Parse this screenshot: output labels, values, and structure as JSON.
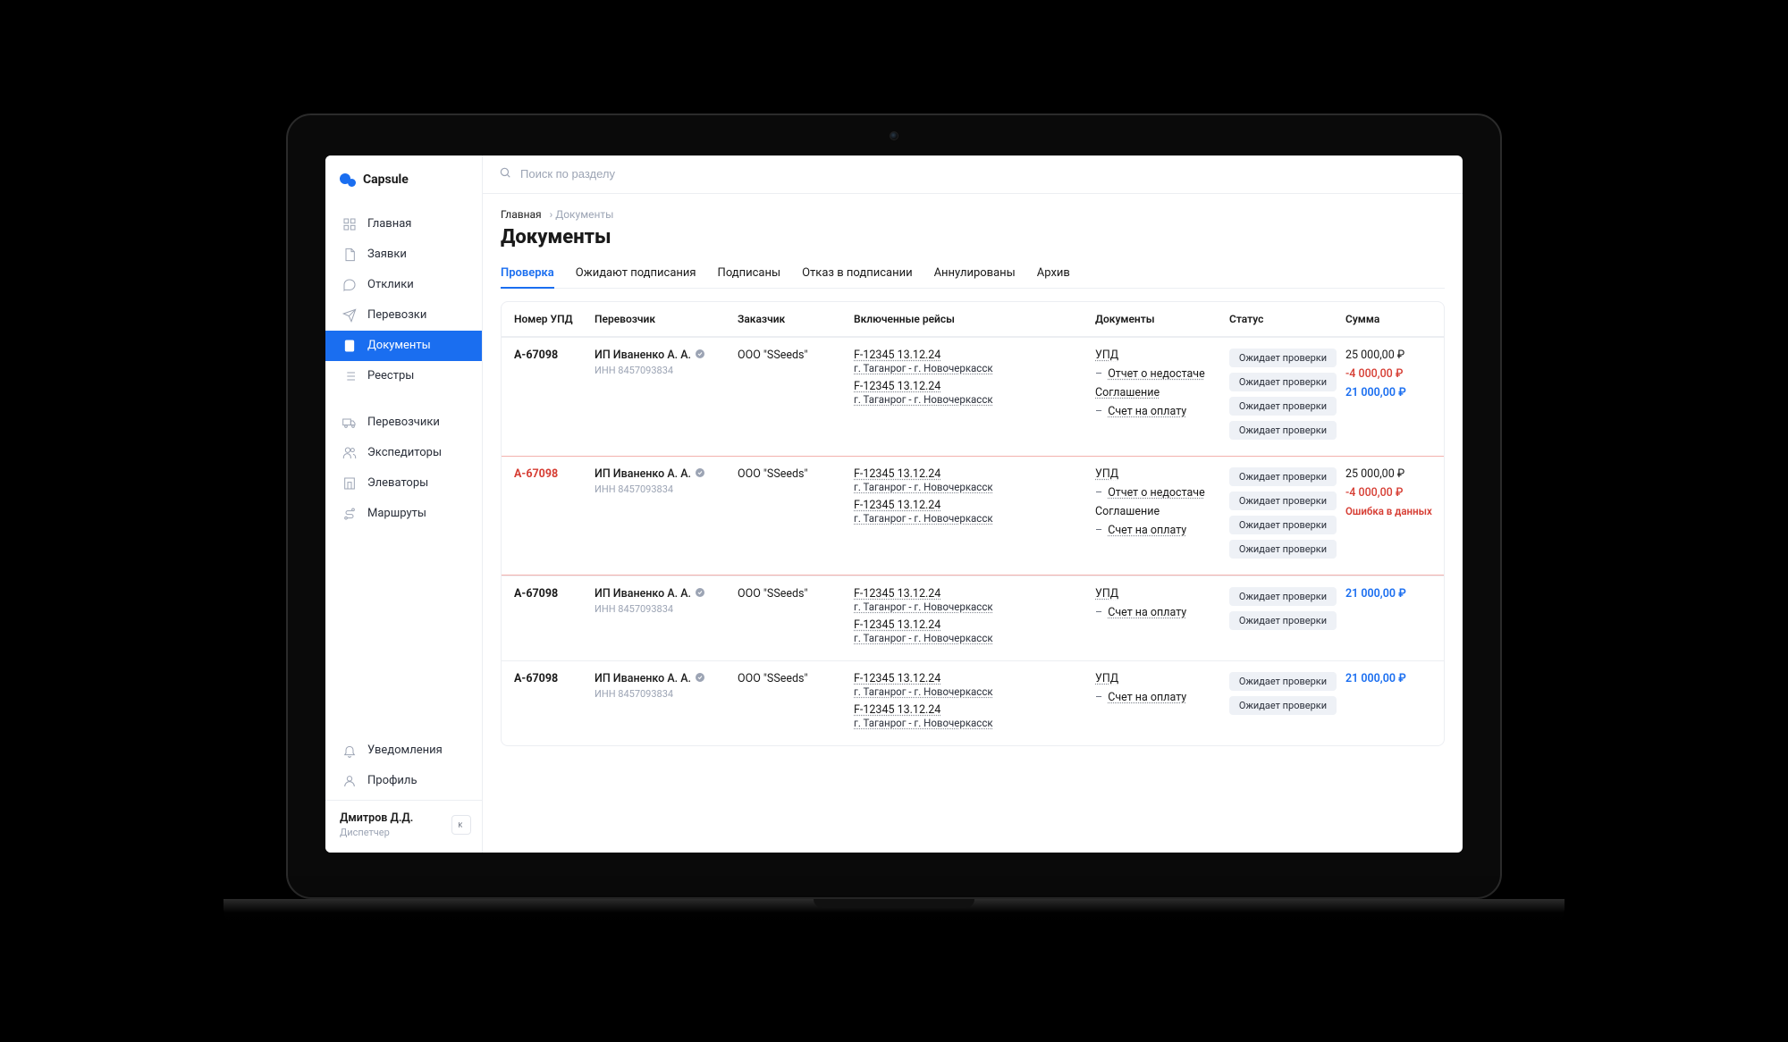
{
  "brand": {
    "name": "Capsule"
  },
  "search": {
    "placeholder": "Поиск по разделу"
  },
  "sidebar": {
    "items": [
      {
        "label": "Главная"
      },
      {
        "label": "Заявки"
      },
      {
        "label": "Отклики"
      },
      {
        "label": "Перевозки"
      },
      {
        "label": "Документы"
      },
      {
        "label": "Реестры"
      },
      {
        "label": "Перевозчики"
      },
      {
        "label": "Экспедиторы"
      },
      {
        "label": "Элеваторы"
      },
      {
        "label": "Маршруты"
      }
    ],
    "bottom": [
      {
        "label": "Уведомления"
      },
      {
        "label": "Профиль"
      }
    ]
  },
  "user": {
    "name": "Дмитров Д.Д.",
    "role": "Диспетчер"
  },
  "breadcrumb": {
    "root": "Главная",
    "current": "Документы"
  },
  "page_title": "Документы",
  "tabs": [
    {
      "label": "Проверка",
      "active": true
    },
    {
      "label": "Ожидают подписания"
    },
    {
      "label": "Подписаны"
    },
    {
      "label": "Отказ в подписании"
    },
    {
      "label": "Аннулированы"
    },
    {
      "label": "Архив"
    }
  ],
  "columns": {
    "id": "Номер УПД",
    "carrier": "Перевозчик",
    "customer": "Заказчик",
    "trips": "Включенные рейсы",
    "docs": "Документы",
    "status": "Статус",
    "sum": "Сумма"
  },
  "status_label": "Ожидает проверки",
  "error_text": "Ошибка в данных",
  "rows": [
    {
      "id": "А-67098",
      "carrier": "ИП Иваненко А. А.",
      "inn": "ИНН 8457093834",
      "customer": "ООО \"SSeeds\"",
      "trips": [
        {
          "code": "F-12345 13.12.24",
          "route": "г. Таганрог - г. Новочеркасск"
        },
        {
          "code": "F-12345 13.12.24",
          "route": "г. Таганрог - г. Новочеркасск"
        }
      ],
      "docs": [
        {
          "label": "УПД",
          "dash": false
        },
        {
          "label": "Отчет о недостаче",
          "dash": true
        },
        {
          "label": "Соглашение",
          "dash": false
        },
        {
          "label": "Счет на оплату",
          "dash": true
        }
      ],
      "sum": {
        "base": "25 000,00 ₽",
        "neg": "-4 000,00 ₽",
        "total": "21 000,00 ₽"
      }
    },
    {
      "id": "А-67098",
      "id_error": true,
      "carrier": "ИП Иваненко А. А.",
      "inn": "ИНН 8457093834",
      "customer": "ООО \"SSeeds\"",
      "trips": [
        {
          "code": "F-12345 13.12.24",
          "route": "г. Таганрог - г. Новочеркасск"
        },
        {
          "code": "F-12345 13.12.24",
          "route": "г. Таганрог - г. Новочеркасск"
        }
      ],
      "docs": [
        {
          "label": "УПД",
          "dash": false
        },
        {
          "label": "Отчет о недостаче",
          "dash": true
        },
        {
          "label": "Соглашение",
          "dash": false,
          "plain": true
        },
        {
          "label": "Счет на оплату",
          "dash": true
        }
      ],
      "sum": {
        "base": "25 000,00 ₽",
        "neg": "-4 000,00 ₽",
        "error": true
      },
      "warn": true
    },
    {
      "id": "А-67098",
      "carrier": "ИП Иваненко А. А.",
      "inn": "ИНН 8457093834",
      "customer": "ООО \"SSeeds\"",
      "trips": [
        {
          "code": "F-12345 13.12.24",
          "route": "г. Таганрог - г. Новочеркасск"
        },
        {
          "code": "F-12345 13.12.24",
          "route": "г. Таганрог - г. Новочеркасск"
        }
      ],
      "docs": [
        {
          "label": "УПД",
          "dash": false
        },
        {
          "label": "Счет на оплату",
          "dash": true
        }
      ],
      "sum": {
        "total": "21 000,00 ₽"
      }
    },
    {
      "id": "А-67098",
      "carrier": "ИП Иваненко А. А.",
      "inn": "ИНН 8457093834",
      "customer": "ООО \"SSeeds\"",
      "trips": [
        {
          "code": "F-12345 13.12.24",
          "route": "г. Таганрог - г. Новочеркасск"
        },
        {
          "code": "F-12345 13.12.24",
          "route": "г. Таганрог - г. Новочеркасск"
        }
      ],
      "docs": [
        {
          "label": "УПД",
          "dash": false
        },
        {
          "label": "Счет на оплату",
          "dash": true
        }
      ],
      "sum": {
        "total": "21 000,00 ₽"
      }
    }
  ]
}
